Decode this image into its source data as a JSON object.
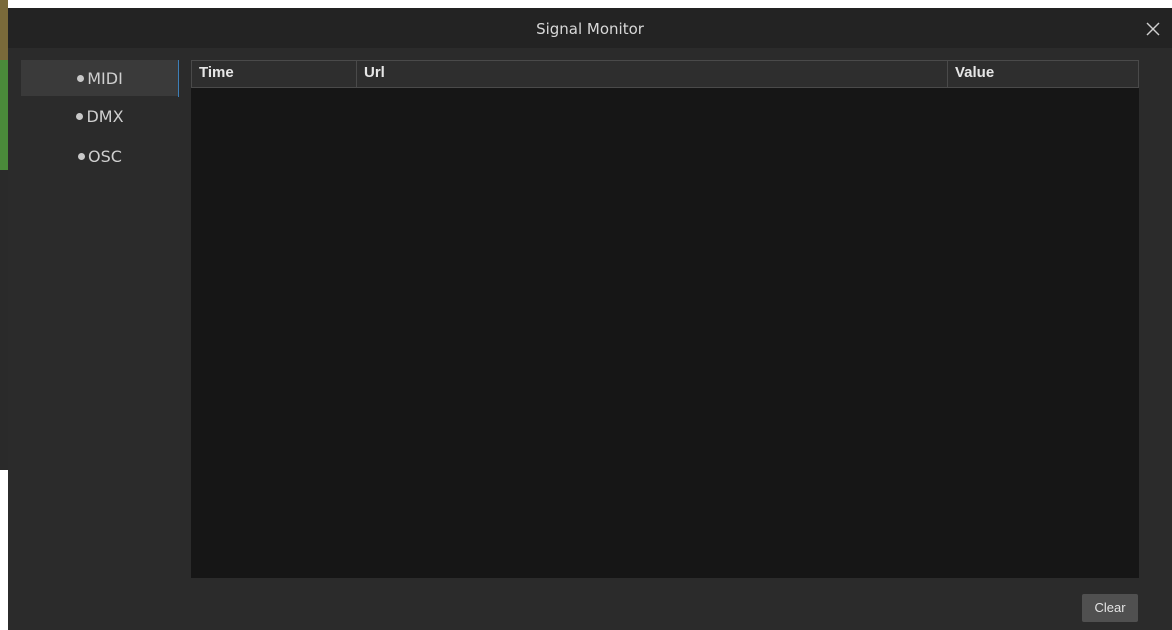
{
  "window": {
    "title": "Signal Monitor",
    "close_icon": "close-icon"
  },
  "sidebar": {
    "items": [
      {
        "label": "MIDI",
        "active": true
      },
      {
        "label": "DMX",
        "active": false
      },
      {
        "label": "OSC",
        "active": false
      }
    ]
  },
  "table": {
    "columns": [
      "Time",
      "Url",
      "Value"
    ],
    "rows": []
  },
  "actions": {
    "clear_label": "Clear"
  },
  "colors": {
    "dialog_bg": "#2b2b2b",
    "titlebar_bg": "#232323",
    "table_bg": "#161616",
    "accent": "#3d7fb8",
    "button_bg": "#505050"
  }
}
